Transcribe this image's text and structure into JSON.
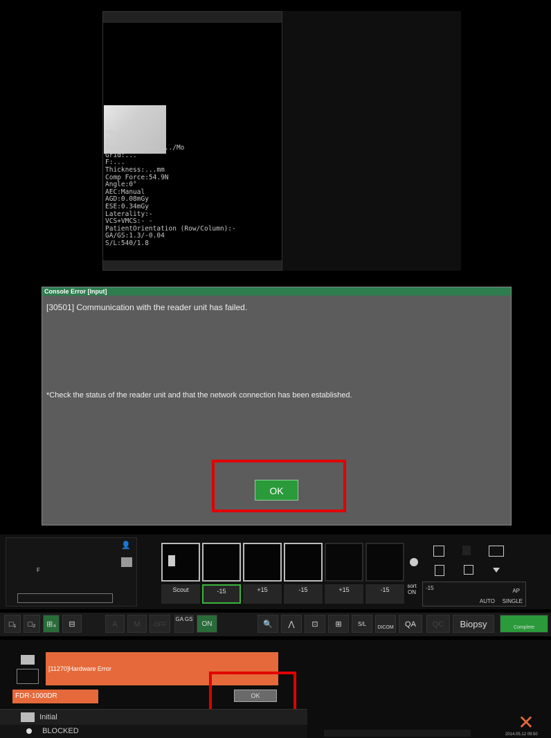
{
  "overlay_text": "PB:...\nS:...\nTarget/Filter:.../Mo\nGrid:...\nF:...\nThickness:...mm\nComp Force:54.9N\nAngle:0°\nAEC:Manual\nAGD:0.08mGy\nESE:0.34mGy\nLaterality:-\nVCS+VMCS:- -\nPatientOrientation (Row/Column):-\nGA/GS:1.3/-0.04\nS/L:540/1.8",
  "dialog": {
    "title": "Console Error [Input]",
    "message": "[30501] Communication with the reader unit has failed.",
    "note": "*Check the status of the reader unit and that the network connection has been established.",
    "ok": "OK"
  },
  "left_panel_label": "F",
  "strip_labels": [
    "Scout",
    "-15",
    "+15",
    "-15",
    "+15",
    "-15"
  ],
  "sort": {
    "label": "sort",
    "state": "ON",
    "value": "-15"
  },
  "right_info": {
    "view": "AP",
    "mode": "AUTO",
    "single": "SINGLE"
  },
  "toolbar": {
    "biopsy": "Biopsy",
    "complete": "Complete",
    "qa": "QA",
    "qc": "QC",
    "sl": "S/L",
    "dicom": "DICOM",
    "ga_gs": "GA GS",
    "on": "ON",
    "off": "OFF"
  },
  "bottom": {
    "hardware_error": "[11270]Hardware Error",
    "device": "FDR-1000DR",
    "ok_small": "OK",
    "initial": "Initial",
    "blocked": "BLOCKED",
    "timestamp": "2014.05.12 09:50"
  }
}
